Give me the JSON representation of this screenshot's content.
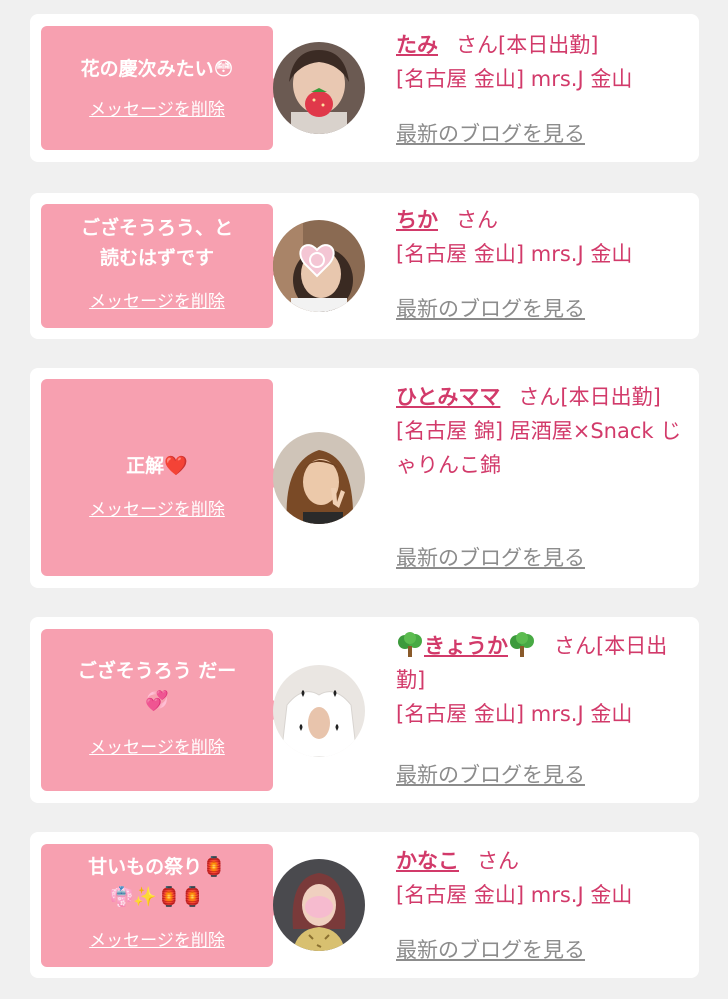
{
  "entries": [
    {
      "bubble_text": "花の慶次みたい😳",
      "delete_label": "メッセージを削除",
      "name": "たみ",
      "san": "さん",
      "status": "[本日出勤]",
      "area": "[名古屋 金山]",
      "shop": "mrs.J 金山",
      "blog_label": "最新のブログを見る"
    },
    {
      "bubble_text": "ござそうろう、と\n読むはずです",
      "delete_label": "メッセージを削除",
      "name": "ちか",
      "san": "さん",
      "status": "",
      "area": "[名古屋 金山]",
      "shop": "mrs.J 金山",
      "blog_label": "最新のブログを見る"
    },
    {
      "bubble_text": "正解❤️",
      "delete_label": "メッセージを削除",
      "name": "ひとみママ",
      "san": "さん",
      "status": "[本日出勤]",
      "area": "[名古屋 錦]",
      "shop": "居酒屋×Snack じゃりんこ錦",
      "blog_label": "最新のブログを見る"
    },
    {
      "bubble_text": "ござそうろう だー\n💞",
      "delete_label": "メッセージを削除",
      "name": "きょうか",
      "san": "さん",
      "status": "[本日出勤]",
      "area": "[名古屋 金山]",
      "shop": "mrs.J 金山",
      "blog_label": "最新のブログを見る"
    },
    {
      "bubble_text": "甘いもの祭り🏮\n👘✨🏮🏮",
      "delete_label": "メッセージを削除",
      "name": "かなこ",
      "san": "さん",
      "status": "",
      "area": "[名古屋 金山]",
      "shop": "mrs.J 金山",
      "blog_label": "最新のブログを見る"
    }
  ],
  "colors": {
    "accent": "#d23a6a",
    "bubble": "#f7a0b0",
    "link_gray": "#8c8c8c",
    "background": "#f0f0f0"
  },
  "icons": {
    "name_decoration": "tree-icon"
  }
}
